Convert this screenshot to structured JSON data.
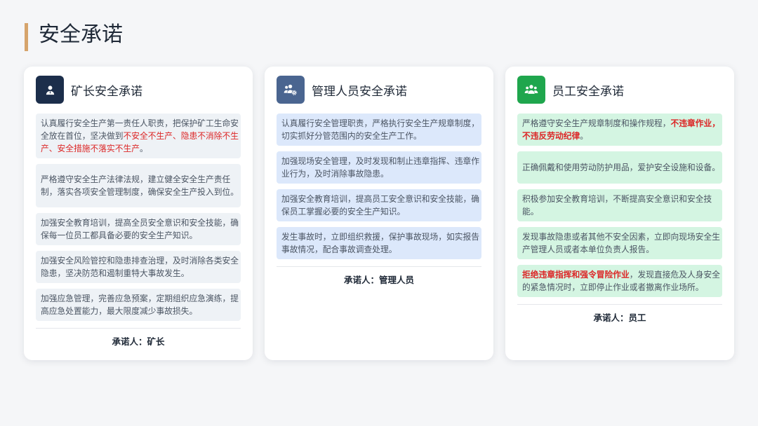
{
  "page": {
    "title": "安全承诺"
  },
  "theme": {
    "background": "#f5f6f8",
    "title_accent": "#d6a46c",
    "highlight": "#dc2626"
  },
  "cards": [
    {
      "title": "矿长安全承诺",
      "icon": "user-tie-icon",
      "icon_color": "#1c2e4b",
      "item_bg": "#eef2f6",
      "items": [
        {
          "parts": [
            {
              "text": "认真履行安全生产第一责任人职责，把保护矿工生命安全放在首位，坚决做到"
            },
            {
              "text": "不安全不生产、隐患不消除不生产、安全措施不落实不生产",
              "emphasis": "red"
            },
            {
              "text": "。"
            }
          ]
        },
        {
          "text": "严格遵守安全生产法律法规，建立健全安全生产责任制，落实各项安全管理制度，确保安全生产投入到位。"
        },
        {
          "text": "加强安全教育培训，提高全员安全意识和安全技能，确保每一位员工都具备必要的安全生产知识。"
        },
        {
          "text": "加强安全风险管控和隐患排查治理，及时消除各类安全隐患，坚决防范和遏制重特大事故发生。"
        },
        {
          "text": "加强应急管理，完善应急预案，定期组织应急演练，提高应急处置能力，最大限度减少事故损失。"
        }
      ],
      "signer": "承诺人：矿长"
    },
    {
      "title": "管理人员安全承诺",
      "icon": "users-cog-icon",
      "icon_color": "#4a6590",
      "item_bg": "#dce8fb",
      "items": [
        {
          "text": "认真履行安全管理职责，严格执行安全生产规章制度，切实抓好分管范围内的安全生产工作。"
        },
        {
          "text": "加强现场安全管理，及时发现和制止违章指挥、违章作业行为，及时消除事故隐患。"
        },
        {
          "text": "加强安全教育培训，提高员工安全意识和安全技能，确保员工掌握必要的安全生产知识。"
        },
        {
          "text": "发生事故时，立即组织救援，保护事故现场，如实报告事故情况，配合事故调查处理。"
        }
      ],
      "signer": "承诺人：管理人员"
    },
    {
      "title": "员工安全承诺",
      "icon": "users-icon",
      "icon_color": "#1fa64d",
      "item_bg": "#d4f5e2",
      "items": [
        {
          "parts": [
            {
              "text": "严格遵守安全生产规章制度和操作规程，"
            },
            {
              "text": "不违章作业，不违反劳动纪律",
              "emphasis": "red-bold"
            },
            {
              "text": "。"
            }
          ]
        },
        {
          "text": "正确佩戴和使用劳动防护用品，爱护安全设施和设备。"
        },
        {
          "text": "积极参加安全教育培训，不断提高安全意识和安全技能。"
        },
        {
          "text": "发现事故隐患或者其他不安全因素，立即向现场安全生产管理人员或者本单位负责人报告。"
        },
        {
          "parts": [
            {
              "text": "拒绝违章指挥和强令冒险作业",
              "emphasis": "red-bold"
            },
            {
              "text": "，发现直接危及人身安全的紧急情况时，立即停止作业或者撤离作业场所。"
            }
          ]
        }
      ],
      "signer": "承诺人：员工"
    }
  ]
}
